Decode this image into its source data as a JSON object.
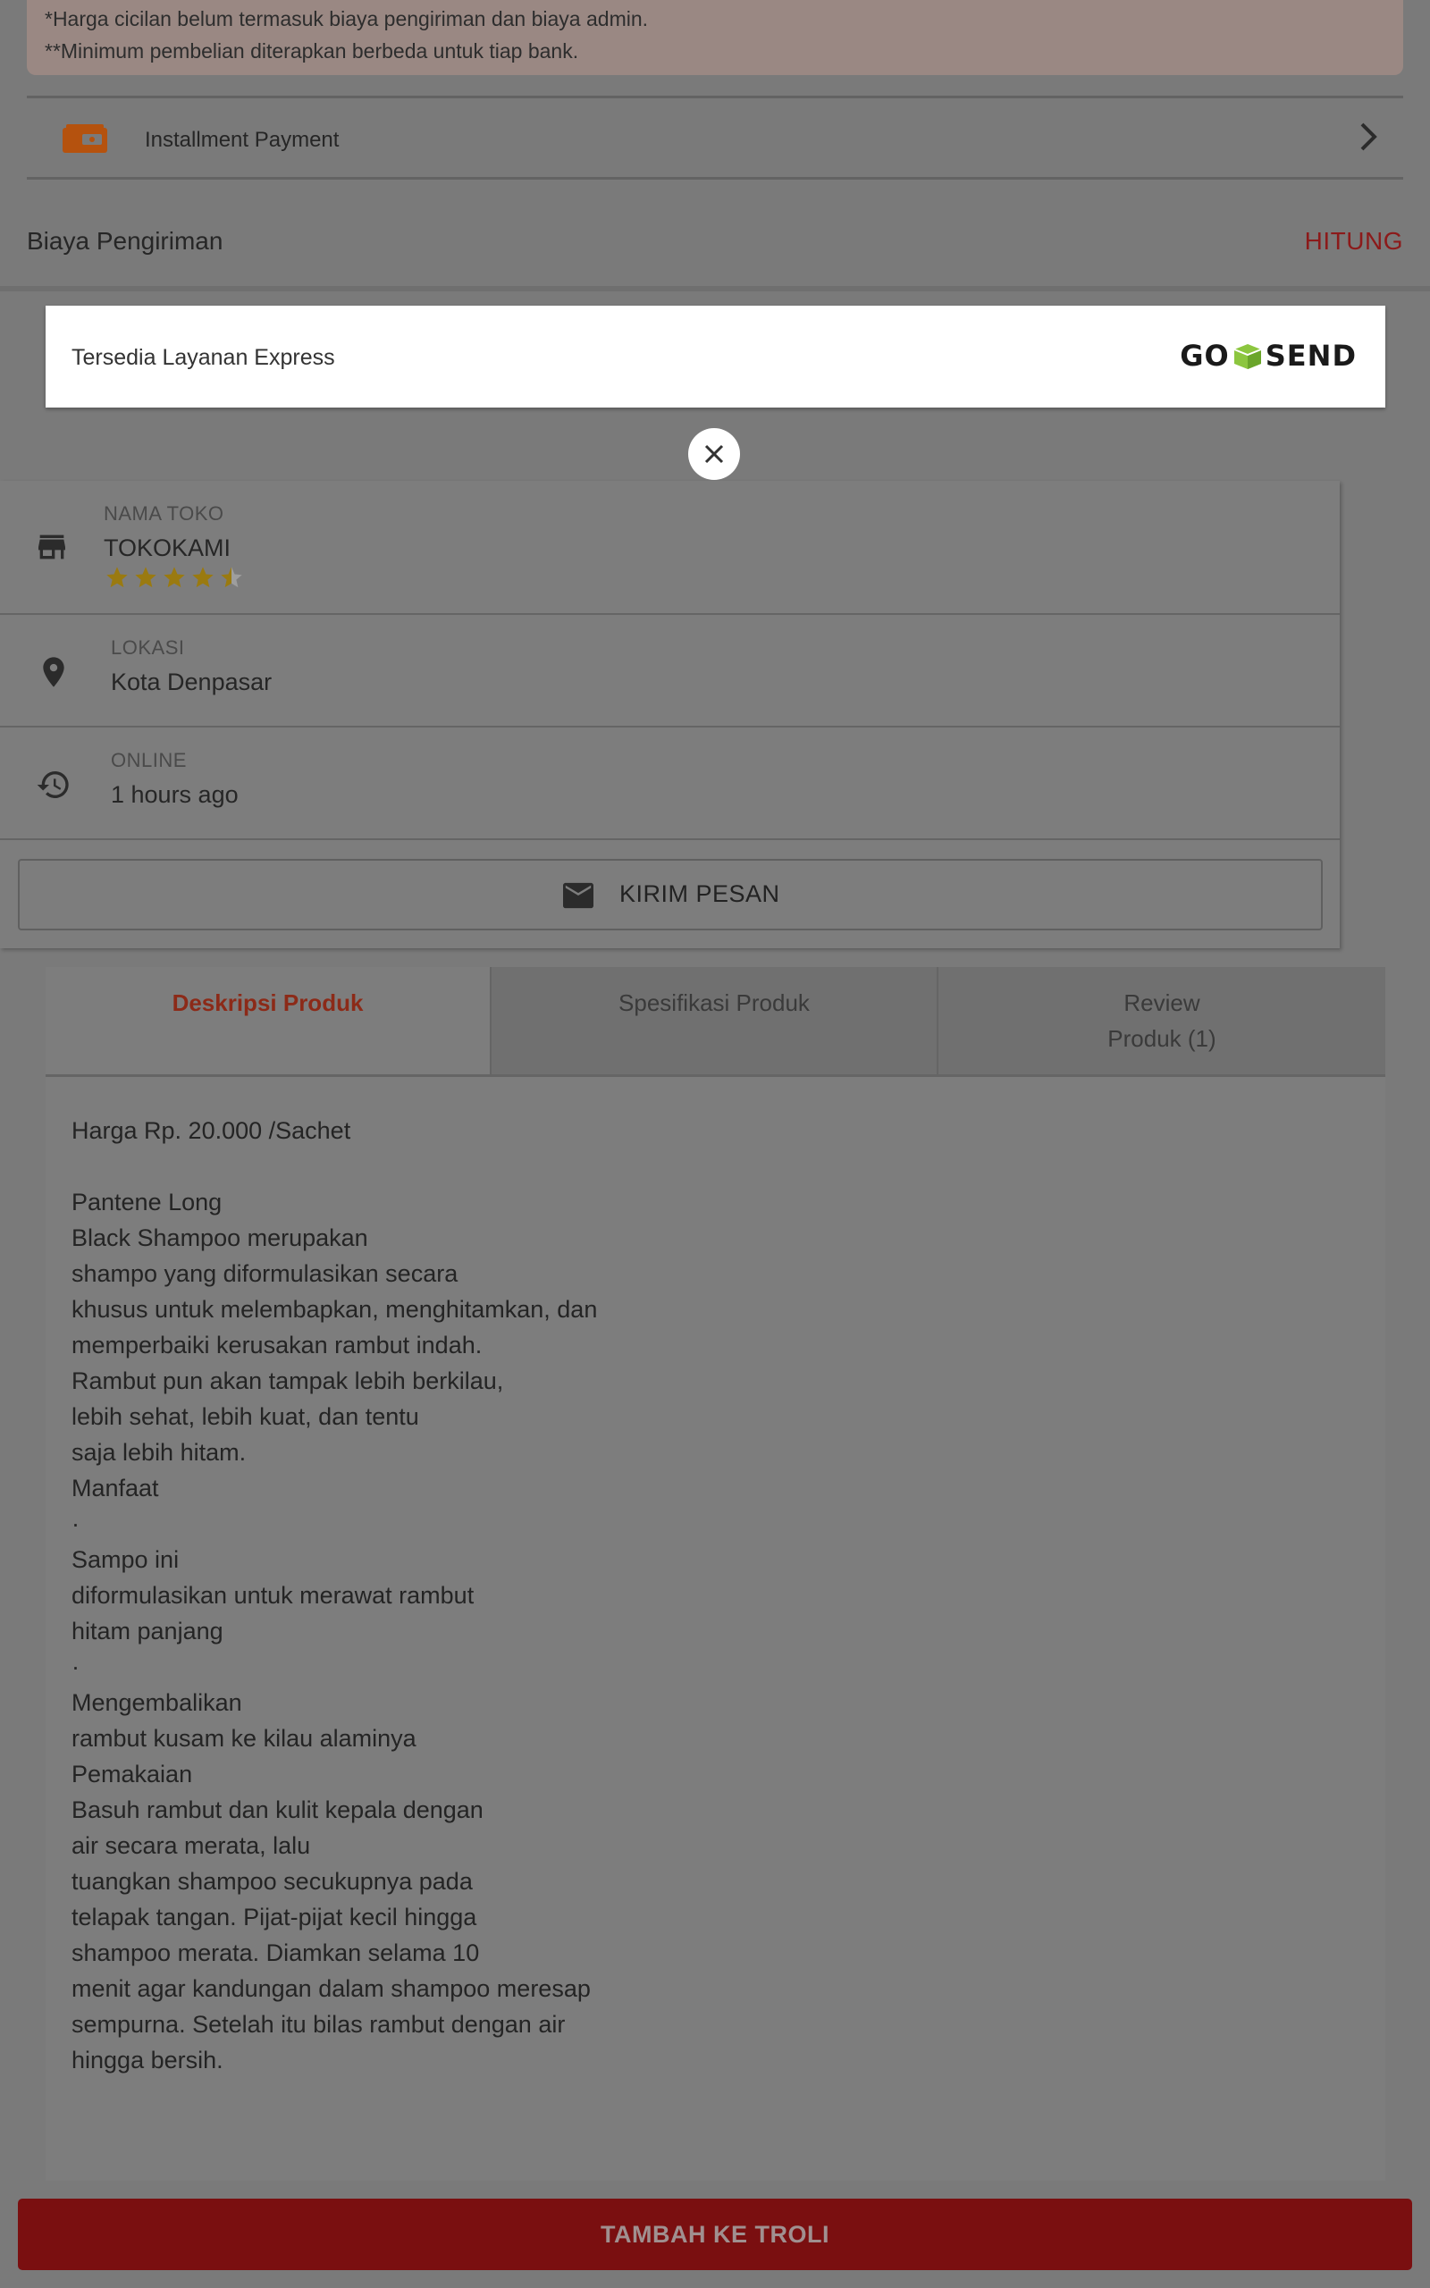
{
  "installment_note": {
    "line1": "*Harga cicilan belum termasuk biaya pengiriman dan biaya admin.",
    "line2": "**Minimum pembelian diterapkan berbeda untuk tiap bank."
  },
  "installment": {
    "label": "Installment Payment",
    "icon": "wallet-icon"
  },
  "shipping": {
    "label": "Biaya Pengiriman",
    "action": "HITUNG"
  },
  "express_popup": {
    "text": "Tersedia Layanan Express",
    "logo_text_left": "GO",
    "logo_text_right": "SEND"
  },
  "shop": {
    "name_caption": "NAMA TOKO",
    "name": "TOKOKAMI",
    "rating_stars": 4.5,
    "rating_max": 5,
    "location_caption": "LOKASI",
    "location": "Kota Denpasar",
    "online_caption": "ONLINE",
    "online": "1 hours ago",
    "message_button": "KIRIM PESAN"
  },
  "tabs": {
    "description": "Deskripsi Produk",
    "specification": "Spesifikasi Produk",
    "review_line1": "Review",
    "review_line2": "Produk (1)"
  },
  "description_lines": [
    "Harga Rp. 20.000 /Sachet",
    "",
    "Pantene Long",
    "Black Shampoo merupakan",
    "shampo yang diformulasikan secara",
    "khusus untuk melembapkan, menghitamkan, dan",
    "memperbaiki kerusakan rambut indah.",
    "Rambut pun akan tampak lebih berkilau,",
    "lebih sehat, lebih kuat, dan tentu",
    "saja lebih hitam.",
    "Manfaat",
    "·",
    "Sampo ini",
    "diformulasikan untuk merawat rambut",
    "hitam panjang",
    "·",
    "Mengembalikan",
    "rambut kusam ke kilau alaminya",
    "Pemakaian",
    "Basuh rambut dan kulit kepala dengan",
    "air secara merata, lalu",
    "tuangkan shampoo secukupnya pada",
    "telapak tangan. Pijat-pijat kecil hingga",
    "shampoo merata. Diamkan selama 10",
    "menit agar kandungan dalam shampoo meresap",
    "sempurna. Setelah itu bilas rambut dengan air",
    "hingga bersih."
  ],
  "cart_button": "TAMBAH KE TROLI",
  "colors": {
    "accent_red": "#8c1a1a",
    "button_red": "#7a0f10",
    "star_gold": "#9a7a10"
  }
}
